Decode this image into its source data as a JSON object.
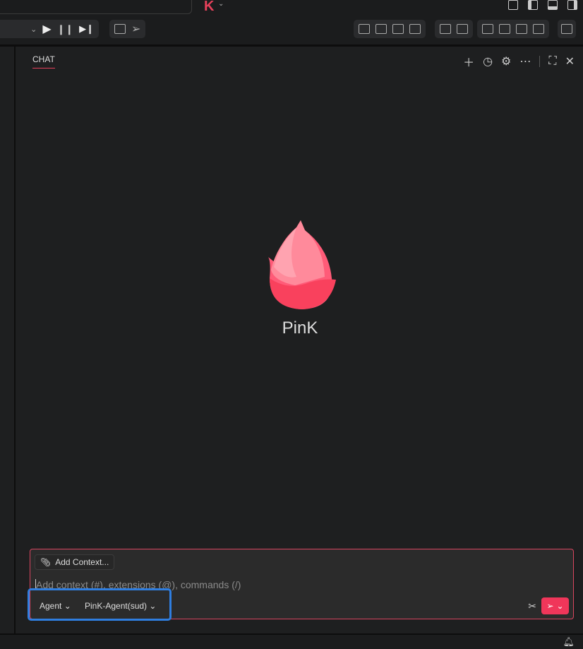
{
  "topbar": {
    "app_letter": "K",
    "chevron": "⌄",
    "layout_icons": [
      "customize-layout-icon",
      "toggle-primary-sidebar-icon",
      "toggle-panel-icon",
      "toggle-secondary-sidebar-icon"
    ]
  },
  "toolbar": {
    "groups": [
      [
        "dropdown-chevron-icon",
        "play-icon",
        "pause-icon",
        "step-icon"
      ],
      [
        "qr-icon",
        "send-icon"
      ],
      [
        "rce-icon",
        "chip-icon",
        "user-icon",
        "file-icon"
      ],
      [
        "mail-icon",
        "edit-icon"
      ],
      [
        "folder-edit-icon",
        "image-edit-icon",
        "file-edit-icon",
        "doc-edit-icon"
      ],
      [
        "ad-icon"
      ]
    ]
  },
  "chat": {
    "tab_label": "CHAT",
    "actions": [
      "plus-icon",
      "history-icon",
      "gear-icon",
      "more-icon",
      "maximize-icon",
      "close-icon"
    ],
    "brand_name": "PinK",
    "colors": {
      "accent": "#f0365a",
      "highlight": "#2f7ee0"
    },
    "input": {
      "add_context_label": "Add Context...",
      "placeholder": "Add context (#), extensions (@), commands (/)",
      "mode": "Agent",
      "agent": "PinK-Agent(sud)"
    }
  }
}
